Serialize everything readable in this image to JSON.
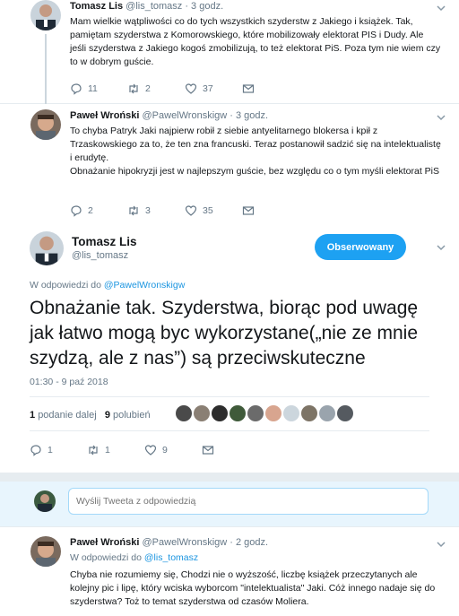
{
  "colors": {
    "accent": "#1da1f2",
    "link": "#1b95e0",
    "muted": "#657786",
    "border": "#e6ecf0",
    "reply_box_bg": "#e8f5fd"
  },
  "tweet1": {
    "name": "Tomasz Lis",
    "meta": "@lis_tomasz · 3 godz.",
    "body": "Mam wielkie wątpliwości co do tych wszystkich szyderstw z Jakiego i książek. Tak, pamiętam szyderstwa z Komorowskiego, które mobilizowały elektorat PIS i Dudy. Ale jeśli szyderstwa z Jakiego kogoś zmobilizują, to też elektorat PiS. Poza tym nie wiem czy to w dobrym guście.",
    "replies": "11",
    "retweets": "2",
    "likes": "37"
  },
  "tweet2": {
    "name": "Paweł Wroński",
    "meta": "@PawelWronskigw · 3 godz.",
    "body_p1": "To chyba Patryk Jaki najpierw robił z siebie antyelitarnego blokersa i kpił z Trzaskowskiego za to, że ten zna francuski. Teraz postanowił sadzić się na intelektualistę i erudytę.",
    "body_p2": "Obnażanie hipokryzji jest w najlepszym guście, bez względu co o tym myśli elektorat PiS",
    "replies": "2",
    "retweets": "3",
    "likes": "35"
  },
  "main": {
    "name": "Tomasz Lis",
    "handle": "@lis_tomasz",
    "follow_label": "Obserwowany",
    "in_reply_prefix": "W odpowiedzi do",
    "in_reply_handle": "@PawelWronskigw",
    "text": "Obnażanie tak. Szyderstwa, biorąc pod uwagę jak łatwo mogą byc wykorzystane(„nie ze mnie szydzą, ale z nas”) są przeciwskuteczne",
    "timestamp": "01:30 - 9 paź 2018",
    "retweet_count": "1",
    "retweet_label": "podanie dalej",
    "like_count": "9",
    "like_label": "polubień",
    "replies": "1",
    "retweets": "1",
    "likes": "9"
  },
  "reply_box": {
    "placeholder": "Wyślij Tweeta z odpowiedzią"
  },
  "tweet3": {
    "name": "Paweł Wroński",
    "meta": "@PawelWronskigw · 2 godz.",
    "reply_prefix": "W odpowiedzi do",
    "reply_handle": "@lis_tomasz",
    "body": "Chyba nie rozumiemy się, Chodzi nie o wyższość, liczbę książek przeczytanych ale kolejny pic i lipę, który wciska wyborcom \"intelektualista\" Jaki. Cóż innego nadaje się do szyderstwa? Toż to temat szyderstwa od czasów Moliera."
  }
}
